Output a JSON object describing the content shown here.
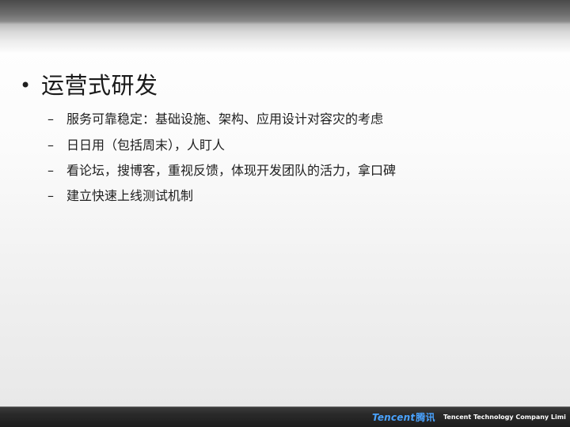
{
  "slide": {
    "title_bullet": "•",
    "title": "运营式研发",
    "item_dash": "–",
    "items": [
      {
        "text": "服务可靠稳定：基础设施、架构、应用设计对容灾的考虑"
      },
      {
        "text": "日日用（包括周末），人盯人"
      },
      {
        "text": "看论坛，搜博客，重视反馈，体现开发团队的活力，拿口碑"
      },
      {
        "text": "建立快速上线测试机制"
      }
    ]
  },
  "footer": {
    "logo_latin": "Tencent",
    "logo_cjk": "腾讯",
    "company_name": "Tencent Technology Company Limited"
  },
  "colors": {
    "logo_blue": "#4aa3ff",
    "footer_bg": "#222222"
  }
}
